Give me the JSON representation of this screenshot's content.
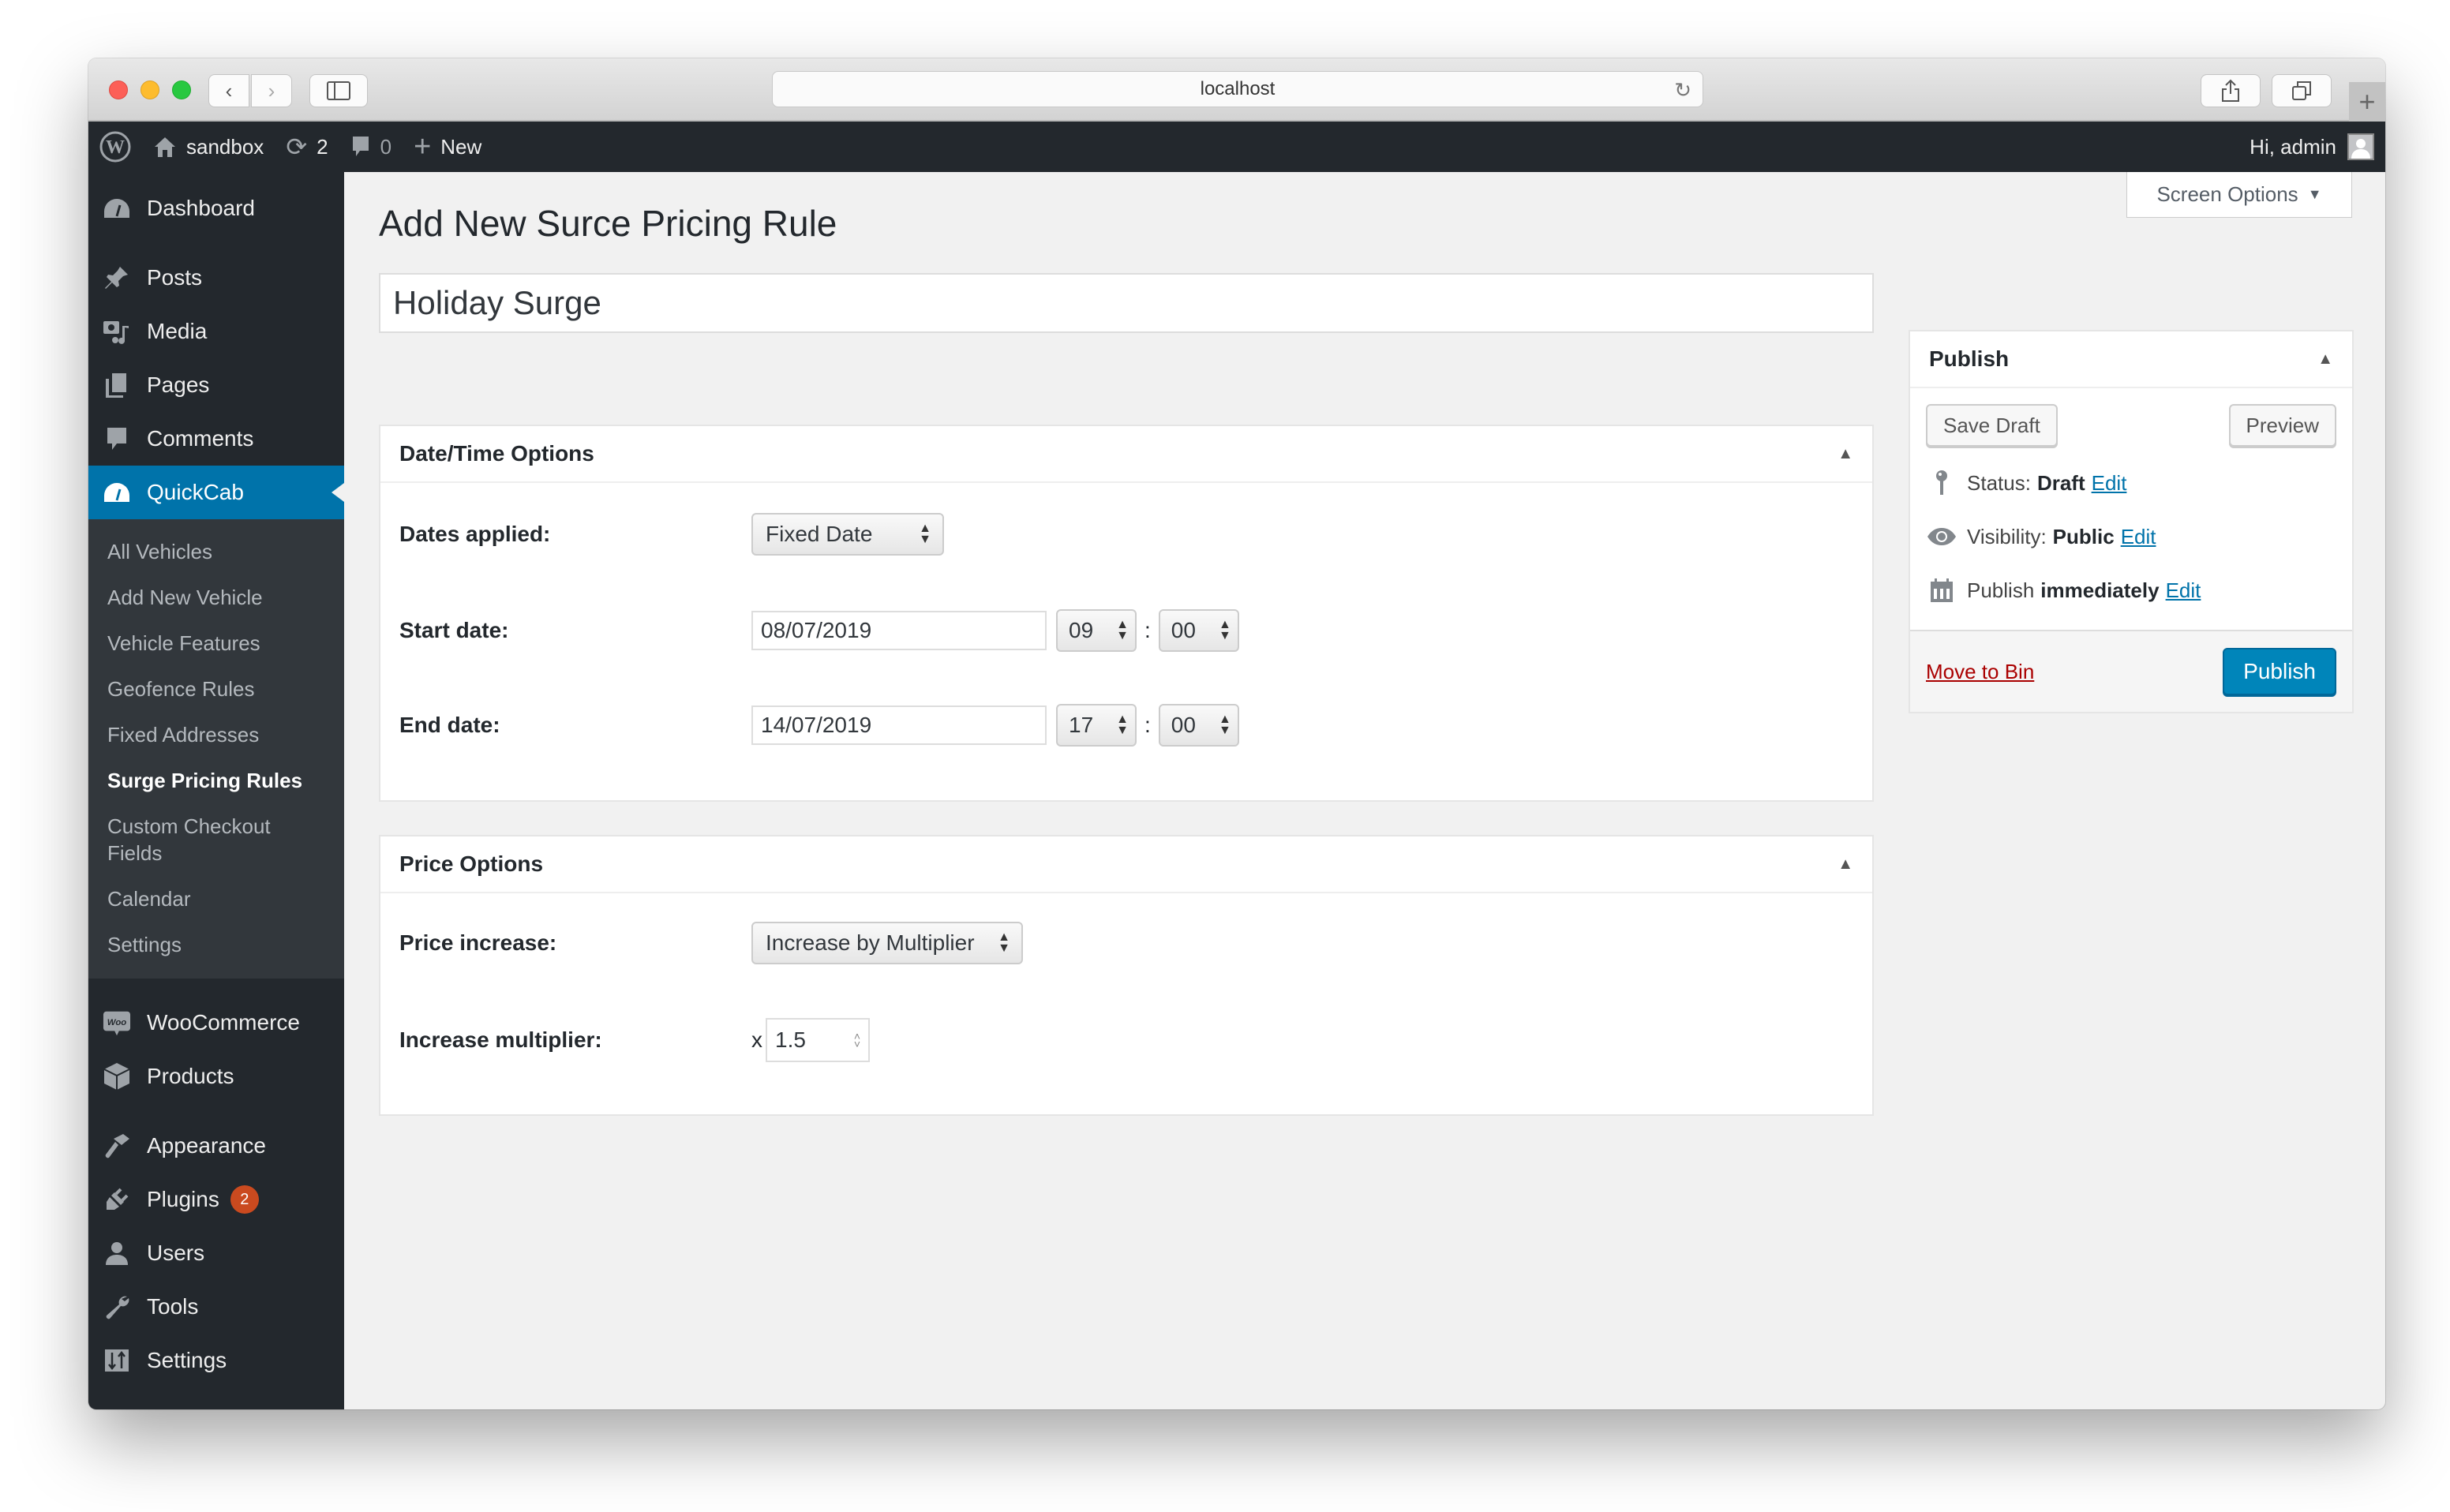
{
  "browser": {
    "url": "localhost",
    "icons": {
      "back": "chevron-left-icon",
      "forward": "chevron-right-icon",
      "sidebar": "sidebar-icon",
      "reload": "reload-icon",
      "share": "share-icon",
      "tabs": "tabs-icon",
      "new_tab": "plus-icon"
    }
  },
  "adminbar": {
    "site_name": "sandbox",
    "updates_count": "2",
    "comments_count": "0",
    "new_label": "New",
    "greeting": "Hi, admin"
  },
  "sidebar": {
    "items_top": [
      {
        "label": "Dashboard",
        "icon": "dashboard-icon"
      }
    ],
    "items_content": [
      {
        "label": "Posts",
        "icon": "pin-icon"
      },
      {
        "label": "Media",
        "icon": "media-icon"
      },
      {
        "label": "Pages",
        "icon": "pages-icon"
      },
      {
        "label": "Comments",
        "icon": "comment-icon"
      }
    ],
    "active_item": {
      "label": "QuickCab",
      "icon": "dashboard-icon"
    },
    "submenu": [
      {
        "label": "All Vehicles",
        "current": false
      },
      {
        "label": "Add New Vehicle",
        "current": false
      },
      {
        "label": "Vehicle Features",
        "current": false
      },
      {
        "label": "Geofence Rules",
        "current": false
      },
      {
        "label": "Fixed Addresses",
        "current": false
      },
      {
        "label": "Surge Pricing Rules",
        "current": true
      },
      {
        "label": "Custom Checkout Fields",
        "current": false
      },
      {
        "label": "Calendar",
        "current": false
      },
      {
        "label": "Settings",
        "current": false
      }
    ],
    "items_commerce": [
      {
        "label": "WooCommerce",
        "icon": "woo-icon"
      },
      {
        "label": "Products",
        "icon": "box-icon"
      }
    ],
    "items_admin": [
      {
        "label": "Appearance",
        "icon": "brush-icon"
      },
      {
        "label": "Plugins",
        "icon": "plugin-icon",
        "badge": "2"
      },
      {
        "label": "Users",
        "icon": "user-icon"
      },
      {
        "label": "Tools",
        "icon": "wrench-icon"
      },
      {
        "label": "Settings",
        "icon": "settings-icon"
      }
    ]
  },
  "main": {
    "screen_options_label": "Screen Options",
    "page_title": "Add New Surce Pricing Rule",
    "post_title_value": "Holiday Surge",
    "datetime_box": {
      "title": "Date/Time Options",
      "dates_applied_label": "Dates applied:",
      "dates_applied_value": "Fixed Date",
      "start_label": "Start date:",
      "start_date": "08/07/2019",
      "start_hour": "09",
      "start_minute": "00",
      "end_label": "End date:",
      "end_date": "14/07/2019",
      "end_hour": "17",
      "end_minute": "00",
      "time_separator": ":"
    },
    "price_box": {
      "title": "Price Options",
      "price_increase_label": "Price increase:",
      "price_increase_value": "Increase by Multiplier",
      "multiplier_label": "Increase multiplier:",
      "multiplier_prefix": "x",
      "multiplier_value": "1.5"
    }
  },
  "publish": {
    "title": "Publish",
    "save_draft_label": "Save Draft",
    "preview_label": "Preview",
    "status_label": "Status:",
    "status_value": "Draft",
    "visibility_label": "Visibility:",
    "visibility_value": "Public",
    "schedule_label": "Publish",
    "schedule_value": "immediately",
    "edit_label": "Edit",
    "trash_label": "Move to Bin",
    "publish_label": "Publish"
  },
  "colors": {
    "admin_dark": "#23282d",
    "submenu_bg": "#32373c",
    "accent": "#0073aa",
    "primary_button": "#0085ba",
    "trash_red": "#aa0000",
    "badge": "#ca4a1f"
  }
}
